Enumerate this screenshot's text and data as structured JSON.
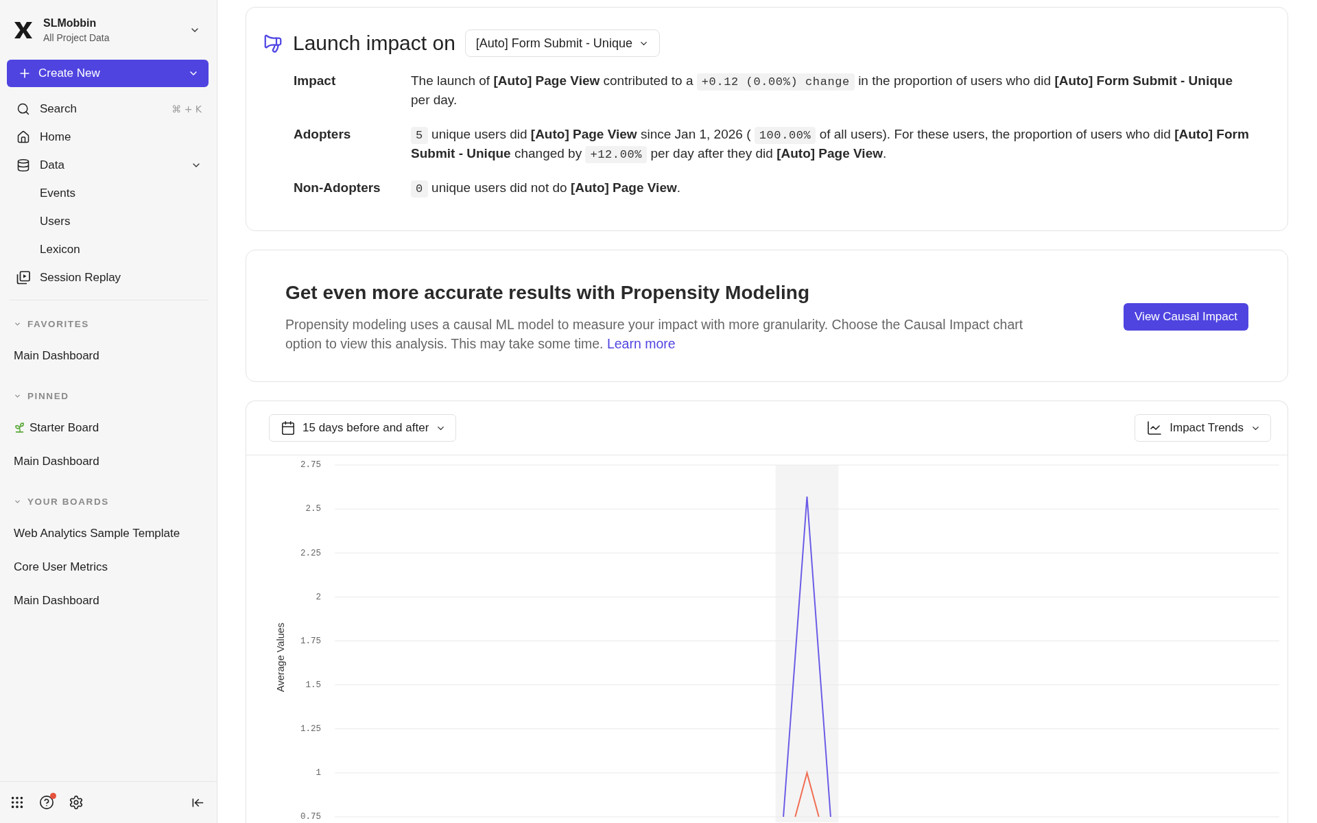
{
  "sidebar": {
    "workspace": {
      "name": "SLMobbin",
      "subtitle": "All Project Data"
    },
    "create_button": "Create New",
    "nav": [
      {
        "kind": "search",
        "label": "Search",
        "shortcut": "⌘ + K"
      },
      {
        "kind": "home",
        "label": "Home"
      },
      {
        "kind": "data",
        "label": "Data",
        "expanded": true,
        "children": [
          {
            "label": "Events"
          },
          {
            "label": "Users"
          },
          {
            "label": "Lexicon"
          }
        ]
      },
      {
        "kind": "replay",
        "label": "Session Replay"
      }
    ],
    "sections": [
      {
        "title": "FAVORITES",
        "expanded": true,
        "items": [
          {
            "kind": "plain",
            "label": "Main Dashboard"
          }
        ]
      },
      {
        "title": "PINNED",
        "expanded": true,
        "items": [
          {
            "kind": "iconed",
            "label": "Starter Board"
          },
          {
            "kind": "plain",
            "label": "Main Dashboard"
          }
        ]
      },
      {
        "title": "YOUR BOARDS",
        "expanded": true,
        "items": [
          {
            "kind": "plain",
            "label": "Web Analytics Sample Template"
          },
          {
            "kind": "plain",
            "label": "Core User Metrics"
          },
          {
            "kind": "plain",
            "label": "Main Dashboard"
          }
        ]
      }
    ],
    "footer": {
      "help_notification": true
    }
  },
  "launch_impact": {
    "title": "Launch impact on",
    "metric": "[Auto] Form Submit - Unique",
    "rows": [
      {
        "label": "Impact",
        "segments": [
          {
            "kind": "text",
            "text": "The launch of **[Auto] Page View** contributed to a"
          },
          {
            "kind": "code",
            "text": "+0.12 (0.00%) change"
          },
          {
            "kind": "text",
            "text": "in the proportion of users who did **[Auto] Form Submit - Unique** per day."
          }
        ]
      },
      {
        "label": "Adopters",
        "segments": [
          {
            "kind": "code",
            "text": "5"
          },
          {
            "kind": "text",
            "text": "unique users did **[Auto] Page View** since Jan 1, 2026 ("
          },
          {
            "kind": "code",
            "text": "100.00%"
          },
          {
            "kind": "text",
            "text": "of all users). For these users, the proportion of users who did **[Auto] Form Submit - Unique** changed by"
          },
          {
            "kind": "code",
            "text": "+12.00%"
          },
          {
            "kind": "text",
            "text": "per day after they did **[Auto] Page View**."
          }
        ]
      },
      {
        "label": "Non-Adopters",
        "segments": [
          {
            "kind": "code",
            "text": "0"
          },
          {
            "kind": "text",
            "text": "unique users did not do **[Auto] Page View**."
          }
        ]
      }
    ]
  },
  "propensity_banner": {
    "title": "Get even more accurate results with Propensity Modeling",
    "description": "Propensity modeling uses a causal ML model to measure your impact with more granularity. Choose the Causal Impact chart option to view this analysis. This may take some time.",
    "link": "Learn more",
    "button": "View Causal Impact"
  },
  "chart_panel": {
    "date_range": "15 days before and after",
    "view": "Impact Trends",
    "launch_highlight": true,
    "chart_data": {
      "type": "line",
      "ylabel": "Average Values",
      "categories": [
        null,
        null,
        null,
        null,
        null,
        null,
        null,
        null,
        null,
        null,
        null,
        null,
        null,
        null,
        null,
        null,
        null,
        null,
        null,
        null,
        null,
        null,
        null,
        null,
        null,
        null,
        null,
        null,
        null,
        null,
        null,
        null,
        null,
        null,
        null,
        null,
        null,
        null,
        null,
        null,
        null,
        null,
        null,
        null,
        null,
        null,
        null,
        null,
        null,
        null,
        null,
        null,
        null,
        null,
        null,
        null,
        null,
        null,
        null,
        null,
        null,
        null,
        null,
        null,
        null,
        null,
        null,
        null,
        null,
        null,
        null,
        null,
        null,
        null,
        null,
        null,
        null,
        null,
        null,
        null,
        null
      ],
      "ylim": [
        0.75,
        2.75
      ],
      "yticks": [
        0.75,
        1,
        1.25,
        1.5,
        1.75,
        2,
        2.25,
        2.5,
        2.75
      ],
      "grid": true,
      "series": [
        {
          "color": "#6b5ce7",
          "values": [
            null,
            null,
            null,
            null,
            null,
            null,
            null,
            null,
            null,
            null,
            null,
            null,
            null,
            null,
            null,
            null,
            null,
            null,
            null,
            null,
            null,
            null,
            null,
            null,
            null,
            null,
            null,
            null,
            null,
            null,
            null,
            null,
            null,
            null,
            null,
            null,
            null,
            null,
            0.75,
            1.66,
            2.57,
            1.66,
            0.75,
            null,
            null,
            null,
            null,
            null,
            null,
            null,
            null,
            null,
            null,
            null,
            null,
            null,
            null,
            null,
            null,
            null,
            null,
            null,
            null,
            null,
            null,
            null,
            null,
            null,
            null,
            null,
            null,
            null,
            null,
            null,
            null,
            null,
            null,
            null,
            null,
            null,
            null
          ]
        },
        {
          "color": "#f06f55",
          "values": [
            null,
            null,
            null,
            null,
            null,
            null,
            null,
            null,
            null,
            null,
            null,
            null,
            null,
            null,
            null,
            null,
            null,
            null,
            null,
            null,
            null,
            null,
            null,
            null,
            null,
            null,
            null,
            null,
            null,
            null,
            null,
            null,
            null,
            null,
            null,
            null,
            null,
            null,
            null,
            0.75,
            1,
            0.75,
            null,
            null,
            null,
            null,
            null,
            null,
            null,
            null,
            null,
            null,
            null,
            null,
            null,
            null,
            null,
            null,
            null,
            null,
            null,
            null,
            null,
            null,
            null,
            null,
            null,
            null,
            null,
            null,
            null,
            null,
            null,
            null,
            null,
            null,
            null,
            null,
            null,
            null,
            null
          ]
        }
      ]
    }
  }
}
